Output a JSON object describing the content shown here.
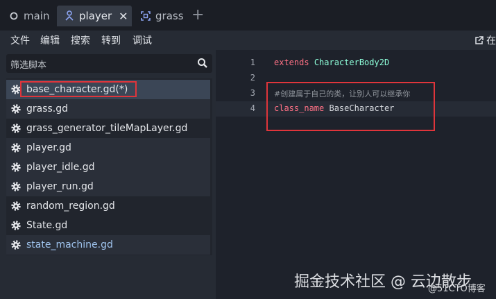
{
  "tabs": [
    {
      "label": "main",
      "icon": "circle-icon"
    },
    {
      "label": "player",
      "icon": "node-tree-icon",
      "active": true
    },
    {
      "label": "grass",
      "icon": "frame-icon"
    }
  ],
  "new_tab_symbol": "+",
  "close_symbol": "✕",
  "menu": [
    "文件",
    "编辑",
    "搜索",
    "转到",
    "调试"
  ],
  "menu_right": {
    "icon": "external-link-icon",
    "label": "在"
  },
  "filter": {
    "placeholder": "筛选脚本",
    "icon": "search-icon"
  },
  "scripts": [
    {
      "name": "base_character.gd(*)",
      "selected": true
    },
    {
      "name": "grass.gd"
    },
    {
      "name": "grass_generator_tileMapLayer.gd"
    },
    {
      "name": "player.gd"
    },
    {
      "name": "player_idle.gd"
    },
    {
      "name": "player_run.gd"
    },
    {
      "name": "random_region.gd"
    },
    {
      "name": "State.gd"
    },
    {
      "name": "state_machine.gd",
      "highlight": true
    }
  ],
  "editor": {
    "line_numbers": [
      "1",
      "2",
      "3",
      "4"
    ],
    "line1": {
      "kw": "extends",
      "type": "CharacterBody2D"
    },
    "line3": {
      "comment": "#创建属于自己的类，让别人可以继承你"
    },
    "line4": {
      "kw": "class_name",
      "ident": "BaseCharacter"
    }
  },
  "watermark": {
    "main": "掘金技术社区 @ 云边散步",
    "sub": "@51CTO博客"
  },
  "colors": {
    "accent_red": "#e0353b",
    "keyword": "#ff7185",
    "type": "#8effda",
    "selection": "#3b4656"
  }
}
